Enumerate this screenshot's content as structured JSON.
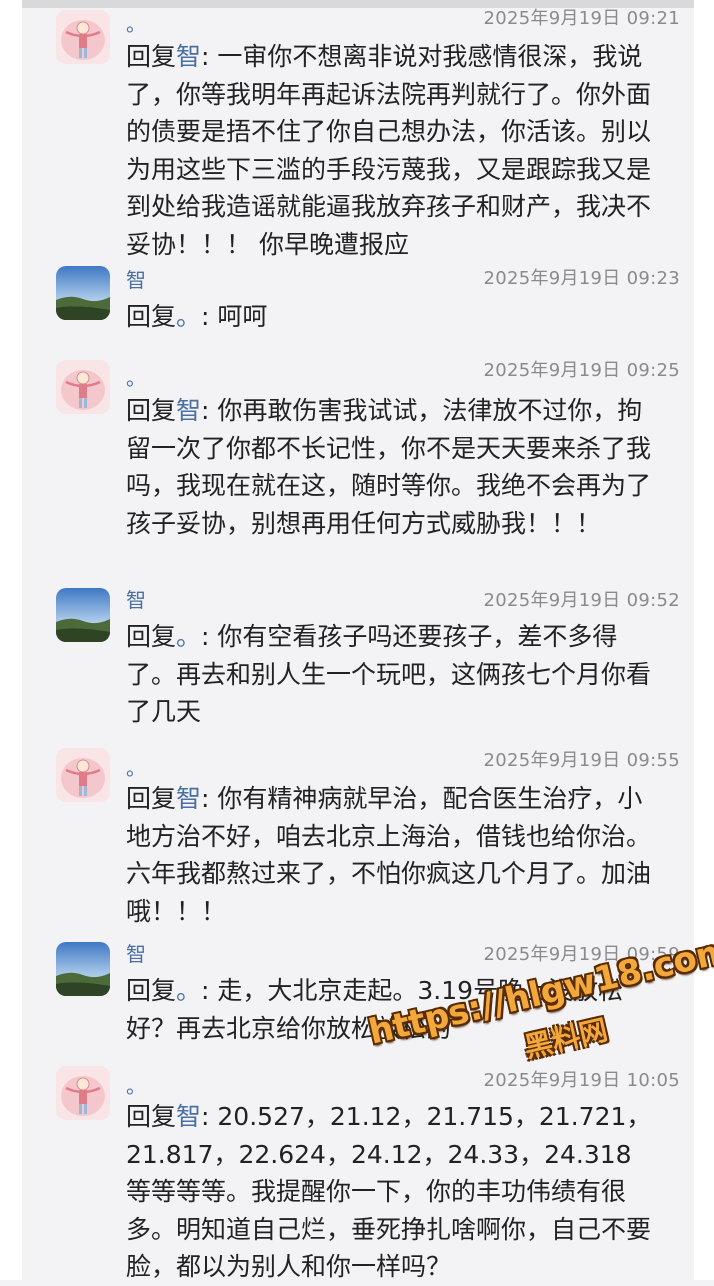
{
  "colors": {
    "name": "#4a6fa5",
    "time": "#8a8a8a",
    "text": "#222222",
    "watermark": "#f2a83a"
  },
  "messages": [
    {
      "sender": "。",
      "avatar": "pink-cartoon-avatar",
      "time": "2025年9月19日 09:21",
      "reply_prefix": "回复",
      "reply_target": "智",
      "text": ": 一审你不想离非说对我感情很深，我说了，你等我明年再起诉法院再判就行了。你外面的债要是捂不住了你自己想办法，你活该。别以为用这些下三滥的手段污蔑我，又是跟踪我又是到处给我造谣就能逼我放弃孩子和财产，我决不妥协！！！ 你早晚遭报应"
    },
    {
      "sender": "智",
      "avatar": "landscape-avatar",
      "time": "2025年9月19日 09:23",
      "reply_prefix": "回复",
      "reply_target": "。",
      "text": ": 呵呵"
    },
    {
      "sender": "。",
      "avatar": "pink-cartoon-avatar",
      "time": "2025年9月19日 09:25",
      "reply_prefix": "回复",
      "reply_target": "智",
      "text": ": 你再敢伤害我试试，法律放不过你，拘留一次了你都不长记性，你不是天天要来杀了我吗，我现在就在这，随时等你。我绝不会再为了孩子妥协，别想再用任何方式威胁我！！！"
    },
    {
      "sender": "智",
      "avatar": "landscape-avatar",
      "time": "2025年9月19日 09:52",
      "reply_prefix": "回复",
      "reply_target": "。",
      "text": ": 你有空看孩子吗还要孩子，差不多得了。再去和别人生一个玩吧，这俩孩七个月你看了几天"
    },
    {
      "sender": "。",
      "avatar": "pink-cartoon-avatar",
      "time": "2025年9月19日 09:55",
      "reply_prefix": "回复",
      "reply_target": "智",
      "text": ": 你有精神病就早治，配合医生治疗，小地方治不好，咱去北京上海治，借钱也给你治。六年我都熬过来了，不怕你疯这几个月了。加油哦！！！"
    },
    {
      "sender": "智",
      "avatar": "landscape-avatar",
      "time": "2025年9月19日 09:59",
      "reply_prefix": "回复",
      "reply_target": "。",
      "text": ": 走，大北京走起。3.19号晚上没放松好？再去北京给你放松放松的"
    },
    {
      "sender": "。",
      "avatar": "pink-cartoon-avatar",
      "time": "2025年9月19日 10:05",
      "reply_prefix": "回复",
      "reply_target": "智",
      "text": ": 20.527，21.12，21.715，21.721，21.817，22.624，24.12，24.33，24.318等等等等。我提醒你一下，你的丰功伟绩有很多。明知道自己烂，垂死挣扎啥啊你，自己不要脸，都以为别人和你一样吗？"
    }
  ],
  "watermark": {
    "url": "https://hlgw18.com",
    "label": "黑料网"
  }
}
